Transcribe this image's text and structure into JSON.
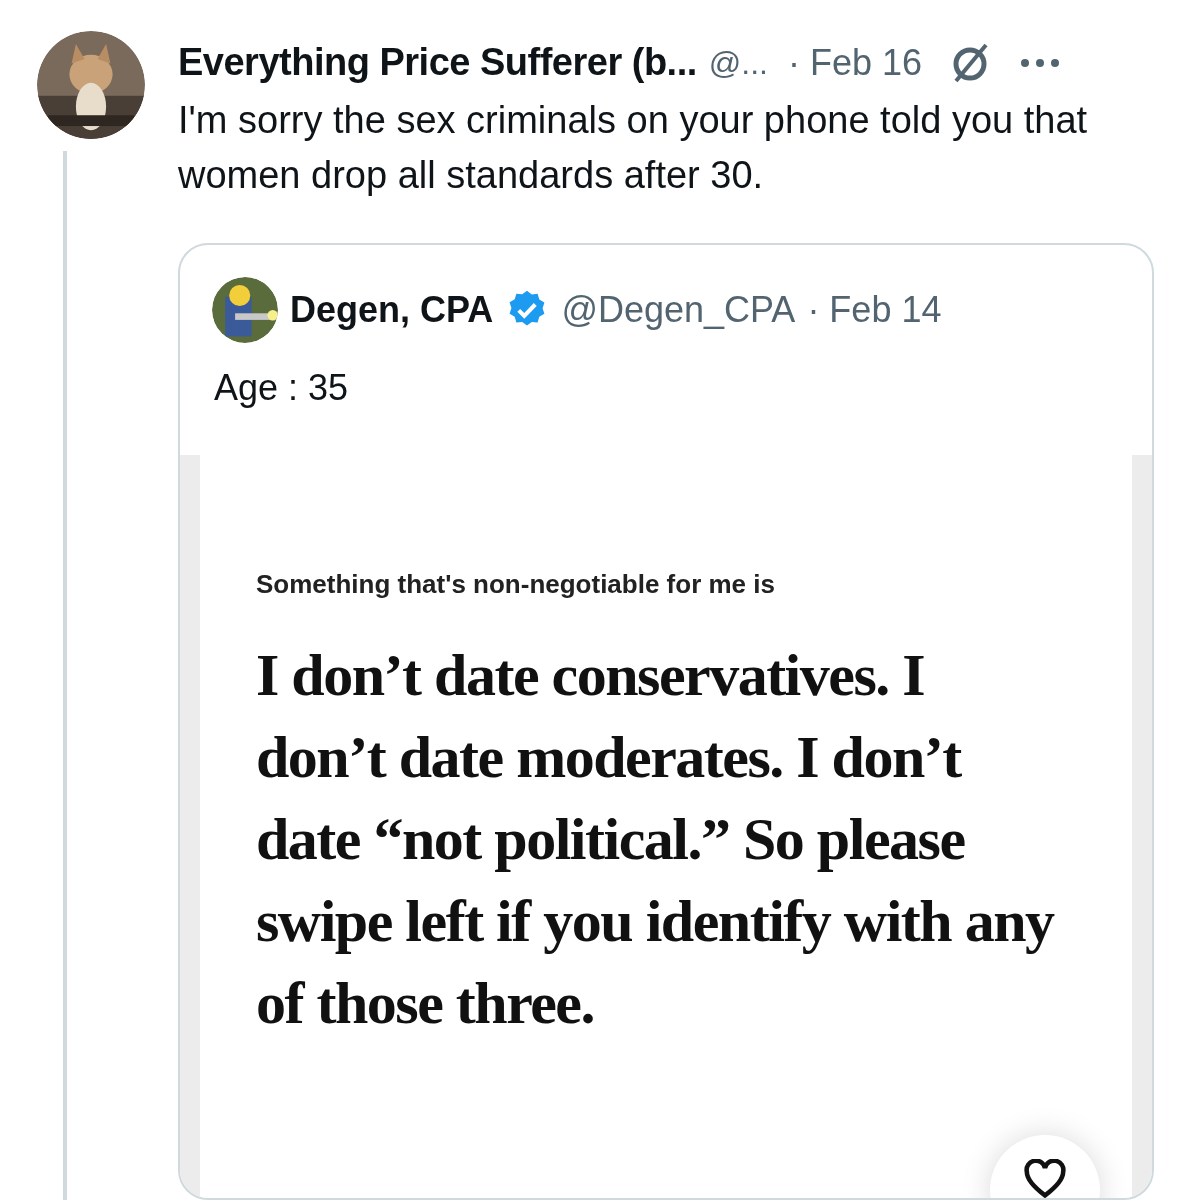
{
  "tweet": {
    "author_name": "Everything Price Sufferer (b...",
    "handle": "@...",
    "date": "· Feb 16",
    "text": "I'm sorry the sex criminals on your phone told you that women drop all standards after 30."
  },
  "quote": {
    "author_name": "Degen, CPA",
    "verified": true,
    "handle": "@Degen_CPA",
    "date": "· Feb 14",
    "text": "Age : 35",
    "image": {
      "prompt": "Something that's non-negotiable for me is",
      "answer": "I don’t date conservatives. I don’t date moderates. I don’t date “not political.” So please swipe left if you identify with any of those three."
    }
  }
}
